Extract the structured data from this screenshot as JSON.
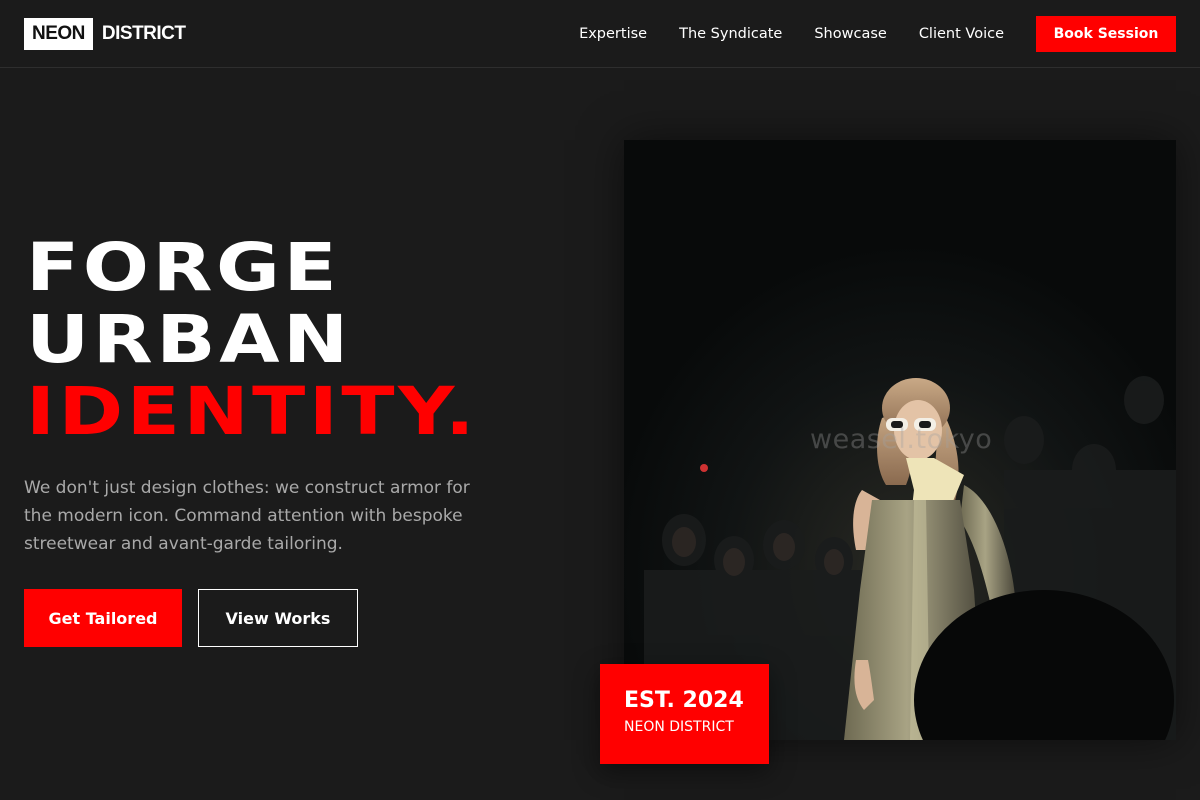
{
  "header": {
    "logo_box": "NEON",
    "logo_text": "DISTRICT",
    "nav": [
      "Expertise",
      "The Syndicate",
      "Showcase",
      "Client Voice"
    ],
    "cta": "Book Session"
  },
  "hero": {
    "headline_line1": "FORGE",
    "headline_line2": "URBAN",
    "headline_line3": "IDENTITY.",
    "subtext": "We don't just design clothes: we construct armor for the modern icon. Command attention with bespoke streetwear and avant-garde tailoring.",
    "primary_cta": "Get Tailored",
    "secondary_cta": "View Works"
  },
  "image": {
    "watermark": "weasel.tokyo"
  },
  "badge": {
    "year": "EST. 2024",
    "label": "NEON DISTRICT"
  },
  "colors": {
    "background": "#1b1b1b",
    "accent": "#ff0000",
    "text": "#ffffff",
    "muted": "#a9a9a9"
  }
}
